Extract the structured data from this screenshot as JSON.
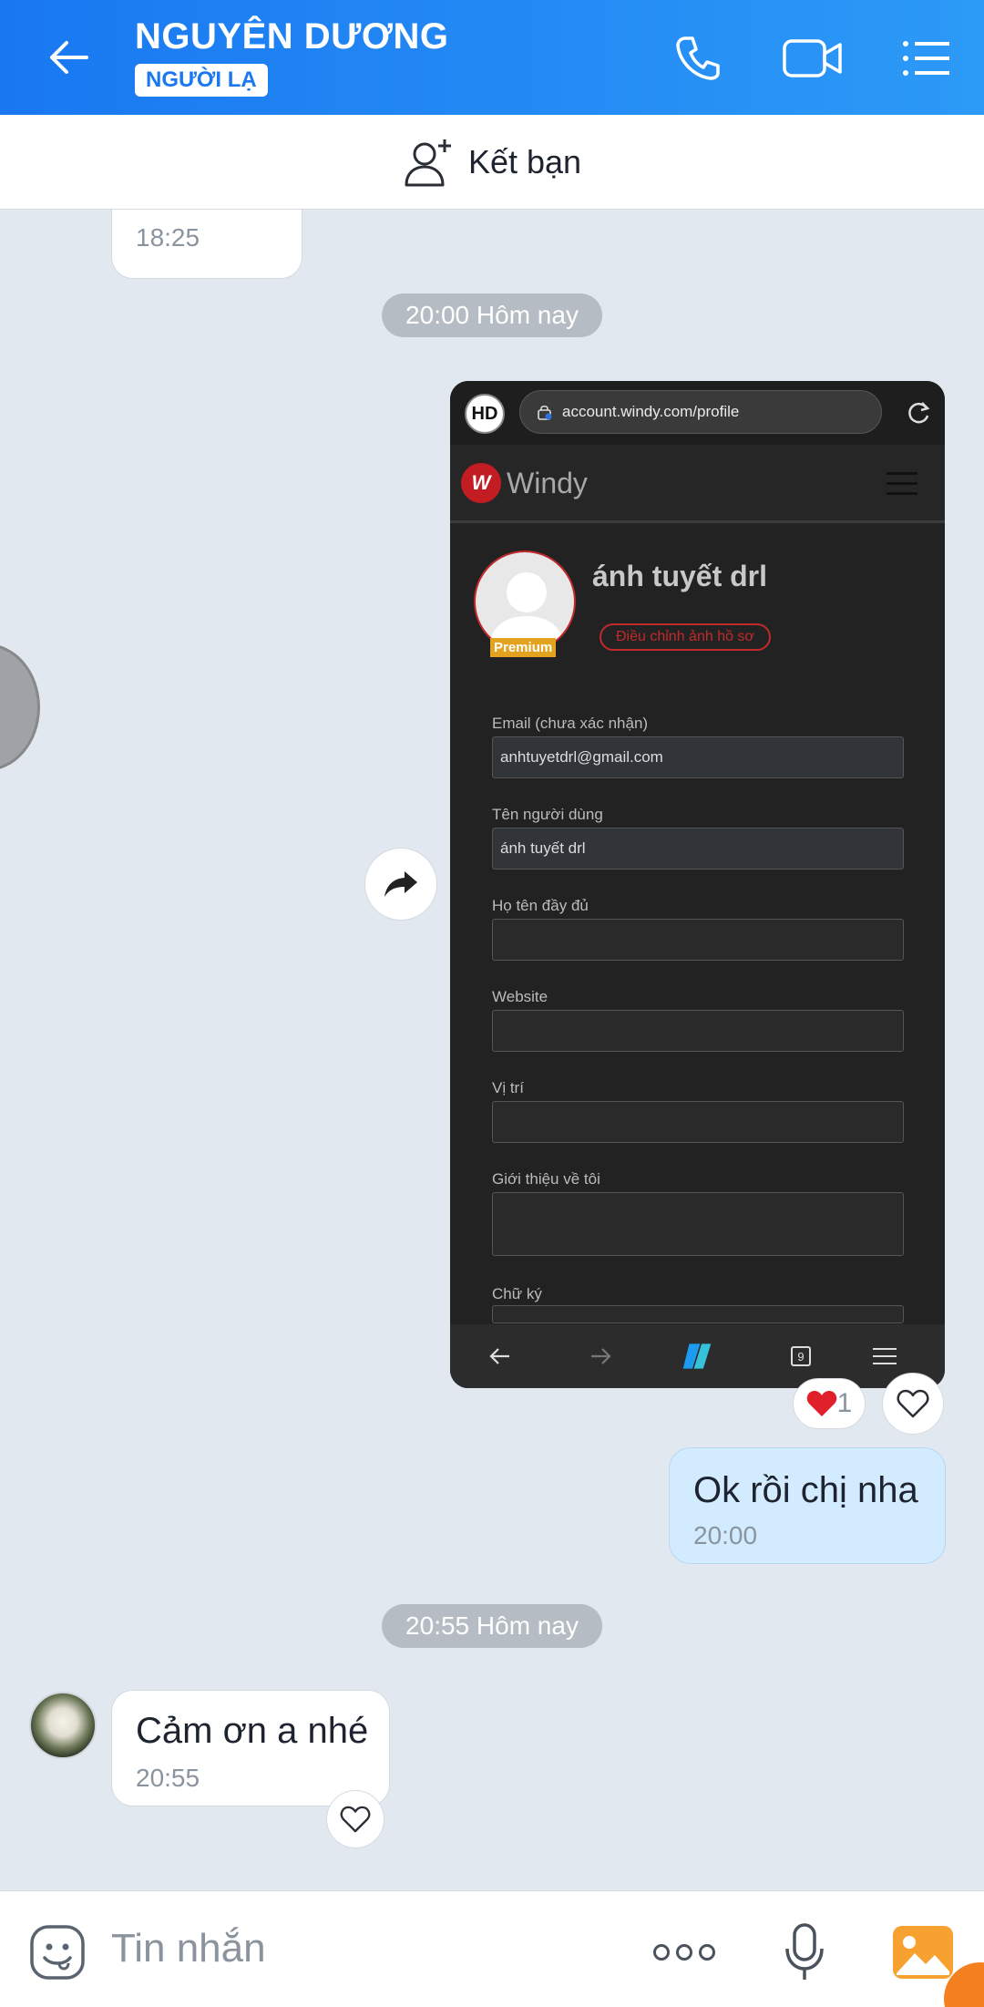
{
  "header": {
    "contact_name": "NGUYÊN DƯƠNG",
    "badge": "NGƯỜI LẠ"
  },
  "friend_bar": {
    "label": "Kết bạn"
  },
  "messages": {
    "top_time": "18:25",
    "date_1": "20:00 Hôm nay",
    "reaction_count": "1",
    "out_text": "Ok rồi chị nha",
    "out_time": "20:00",
    "date_2": "20:55 Hôm nay",
    "in_text": "Cảm ơn a nhé",
    "in_time": "20:55"
  },
  "shot": {
    "logo_text": "HD",
    "url": "account.windy.com/profile",
    "brand": "Windy",
    "premium": "Premium",
    "username": "ánh tuyết drl",
    "edit_photo": "Điều chỉnh ảnh hồ sơ",
    "fields": [
      {
        "label": "Email (chưa xác nhận)",
        "value": "anhtuyetdrl@gmail.com"
      },
      {
        "label": "Tên người dùng",
        "value": "ánh tuyết drl"
      },
      {
        "label": "Họ tên đầy đủ",
        "value": ""
      },
      {
        "label": "Website",
        "value": ""
      },
      {
        "label": "Vị trí",
        "value": ""
      },
      {
        "label": "Giới thiệu về tôi",
        "value": ""
      },
      {
        "label": "Chữ ký",
        "value": ""
      }
    ],
    "tab_count": "9"
  },
  "input": {
    "placeholder": "Tin nhắn"
  },
  "colors": {
    "header": "#1a7ff2",
    "bubble_out": "#d3ebff",
    "background": "#e2e8ef"
  }
}
